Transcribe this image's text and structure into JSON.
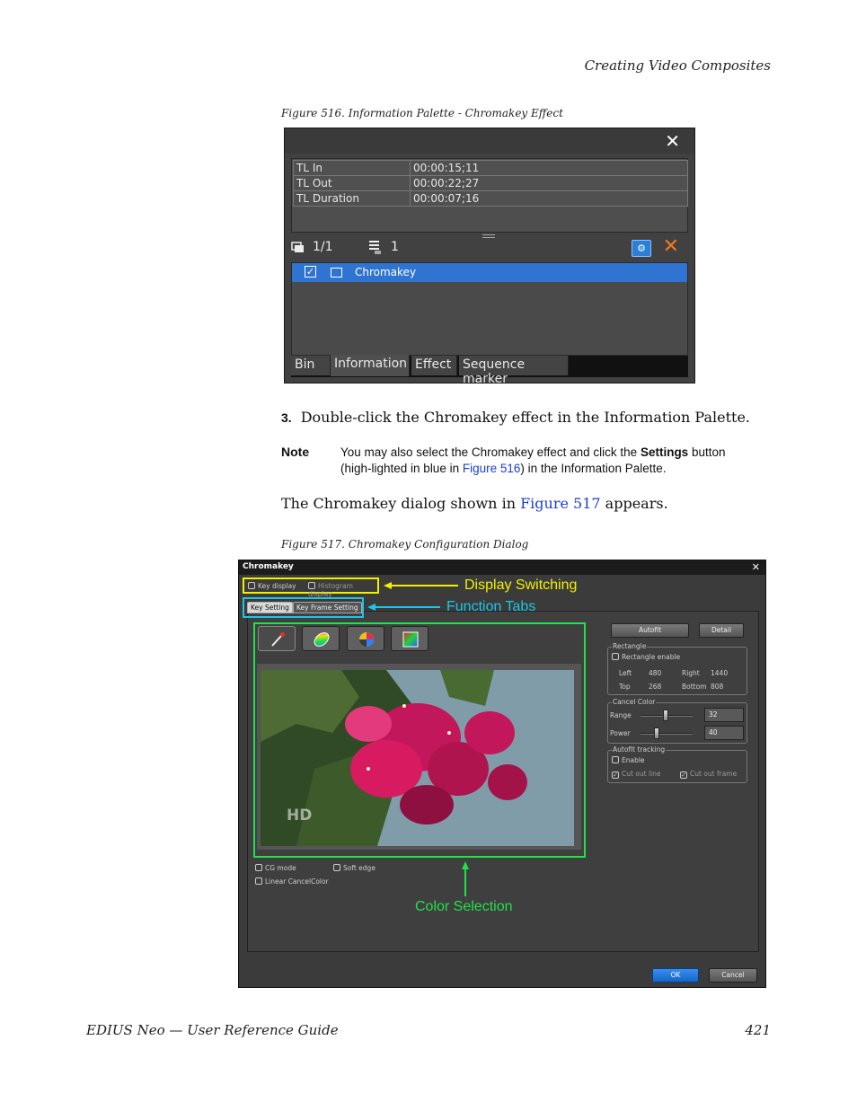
{
  "header": {
    "running_title": "Creating Video Composites"
  },
  "figure516": {
    "caption": "Figure 516.  Information Palette - Chromakey Effect",
    "close_glyph": "✕",
    "info_rows": [
      {
        "label": "TL In",
        "value": "00:00:15;11"
      },
      {
        "label": "TL Out",
        "value": "00:00:22;27"
      },
      {
        "label": "TL Duration",
        "value": "00:00:07;16"
      }
    ],
    "toolbar": {
      "layer_count": "1/1",
      "effect_count": "1",
      "delete_glyph": "✕",
      "settings_glyph": "⚙"
    },
    "effect": {
      "name": "Chromakey",
      "check_glyph": "✓"
    },
    "tabs": [
      "Bin",
      "Information",
      "Effect",
      "Sequence marker"
    ],
    "active_tab": "Information"
  },
  "step": {
    "number": "3.",
    "text": "Double-click the Chromakey effect in the Information Palette."
  },
  "note": {
    "label": "Note",
    "before": "You may also select the Chromakey effect and click the ",
    "bold": "Settings",
    "middle": " button (high-lighted in blue in ",
    "link": "Figure 516",
    "after": ") in the Information Palette."
  },
  "paragraph": {
    "before": "The Chromakey dialog shown in ",
    "link": "Figure 517",
    "after": " appears."
  },
  "figure517": {
    "caption": "Figure 517.  Chromakey Configuration Dialog",
    "dialog_title": "Chromakey",
    "close_glyph": "✕",
    "display_options": [
      "Key display",
      "Histogram display"
    ],
    "tabs": [
      "Key Setting",
      "Key Frame Setting"
    ],
    "preview_watermark": "HD",
    "bottom_options": [
      "CG mode",
      "Soft edge",
      "Linear CancelColor"
    ],
    "buttons": {
      "autofit": "Autofit",
      "detail": "Detail",
      "ok": "OK",
      "cancel": "Cancel"
    },
    "rectangle": {
      "title": "Rectangle",
      "enable_label": "Rectangle enable",
      "left_label": "Left",
      "left_value": "480",
      "right_label": "Right",
      "right_value": "1440",
      "top_label": "Top",
      "top_value": "268",
      "bottom_label": "Bottom",
      "bottom_value": "808"
    },
    "cancel_color": {
      "title": "Cancel Color",
      "range_label": "Range",
      "range_value": "32",
      "power_label": "Power",
      "power_value": "40"
    },
    "autofit_tracking": {
      "title": "Autofit tracking",
      "enable_label": "Enable",
      "cut_out_line": "Cut out line",
      "cut_out_frame": "Cut out frame"
    },
    "callouts": {
      "display_switching": "Display Switching",
      "function_tabs": "Function Tabs",
      "color_selection": "Color Selection"
    },
    "colors": {
      "display_switching": "#f2f000",
      "function_tabs": "#19c8e8",
      "color_selection": "#22e04a"
    }
  },
  "footer": {
    "guide_title": "EDIUS Neo  —  User Reference Guide",
    "page_number": "421"
  }
}
